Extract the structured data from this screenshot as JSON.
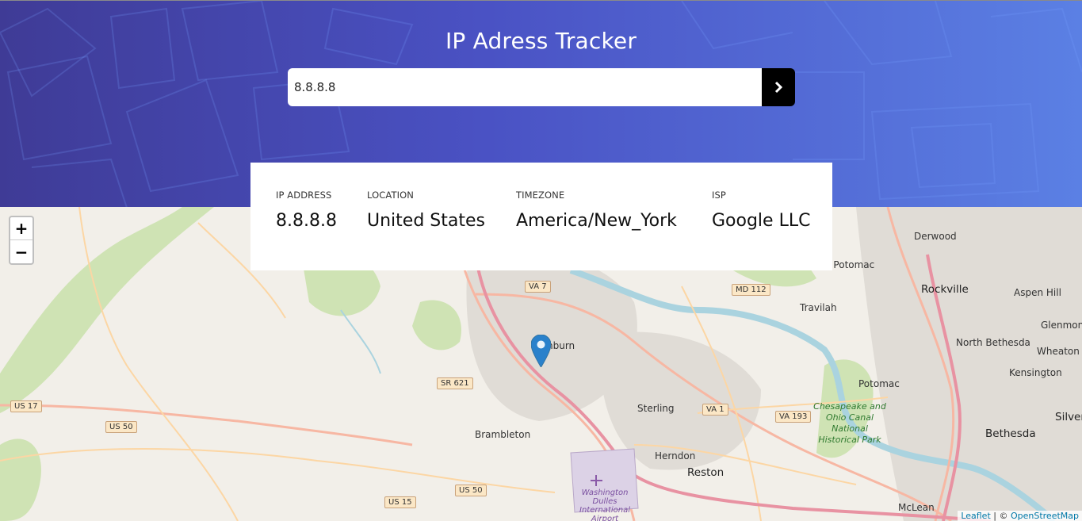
{
  "header": {
    "title": "IP Adress Tracker",
    "search_value": "8.8.8.8"
  },
  "info": {
    "ip_label": "IP ADDRESS",
    "ip_value": "8.8.8.8",
    "location_label": "LOCATION",
    "location_value": "United States",
    "timezone_label": "TIMEZONE",
    "timezone_value": "America/New_York",
    "isp_label": "ISP",
    "isp_value": "Google LLC"
  },
  "map": {
    "zoom_in": "+",
    "zoom_out": "−",
    "attribution_leaflet": "Leaflet",
    "attribution_sep": " | © ",
    "attribution_osm": "OpenStreetMap",
    "labels": {
      "derwood": "Derwood",
      "potomac_n": "h Potomac",
      "rockville": "Rockville",
      "aspen_hill": "Aspen Hill",
      "glenmont": "Glenmont",
      "travilah": "Travilah",
      "north_bethesda": "North Bethesda",
      "wheaton": "Wheaton",
      "kensington": "Kensington",
      "potomac": "Potomac",
      "sterling": "Sterling",
      "brambleton": "Brambleton",
      "herndon": "Herndon",
      "reston": "Reston",
      "bethesda": "Bethesda",
      "silver": "Silver",
      "mclean": "McLean",
      "ashburn": "hburn",
      "airport": "Washington Dulles International Airport",
      "park": "Chesapeake and Ohio Canal National Historical Park"
    },
    "shields": {
      "va7": "VA 7",
      "md112": "MD 112",
      "sr621": "SR 621",
      "va1": "VA 1",
      "va193": "VA 193",
      "us17": "US 17",
      "us50a": "US 50",
      "us50b": "US 50",
      "us15": "US 15"
    }
  },
  "colors": {
    "header_start": "#3f3b96",
    "header_end": "#5b80e4",
    "marker": "#2a81cb"
  }
}
